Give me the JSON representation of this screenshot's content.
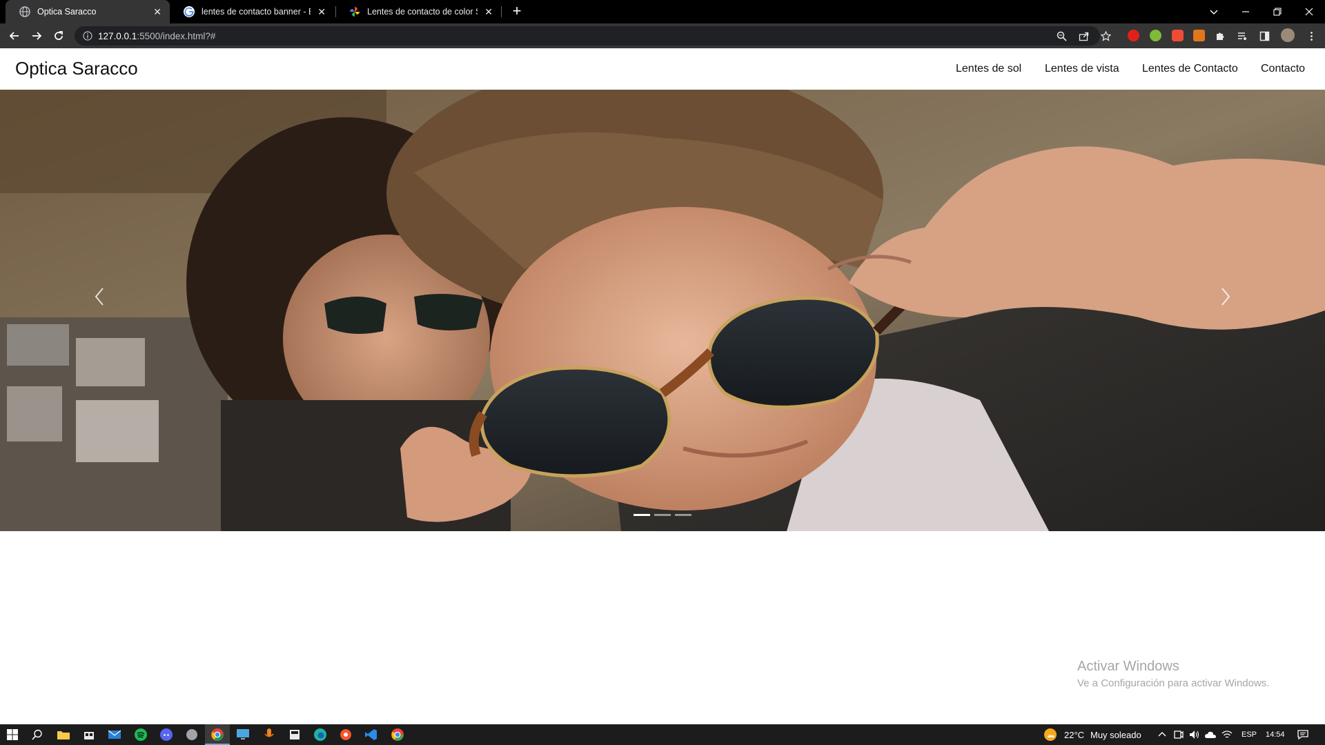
{
  "browser": {
    "tabs": [
      {
        "title": "Optica Saracco",
        "active": true,
        "favicon": "globe-icon"
      },
      {
        "title": "lentes de contacto banner - Búsq",
        "active": false,
        "favicon": "google-icon"
      },
      {
        "title": "Lentes de contacto de color Solo",
        "active": false,
        "favicon": "pinwheel-icon"
      }
    ],
    "close_glyph": "✕",
    "newtab_glyph": "+",
    "url": {
      "host": "127.0.0.1",
      "rest": ":5500/index.html?#"
    },
    "colors": {
      "tabbar": "#000000",
      "toolbar": "#353535",
      "omnibox": "#202124"
    }
  },
  "site": {
    "brand": "Optica Saracco",
    "nav": [
      "Lentes de sol",
      "Lentes de vista",
      "Lentes de Contacto",
      "Contacto"
    ],
    "carousel": {
      "slide_count": 3,
      "active_slide": 1,
      "prev_icon": "chevron-left-icon",
      "next_icon": "chevron-right-icon"
    }
  },
  "watermark": {
    "line1": "Activar Windows",
    "line2": "Ve a Configuración para activar Windows."
  },
  "taskbar": {
    "weather": {
      "temp": "22°C",
      "desc": "Muy soleado"
    },
    "language": "ESP",
    "time": "14:54"
  }
}
